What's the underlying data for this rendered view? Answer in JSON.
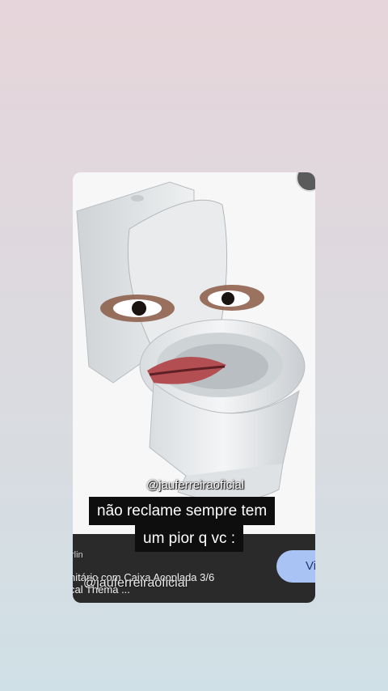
{
  "ad": {
    "seller": "rlin",
    "product_title_line1": "nitário com Caixa Acoplada 3/6",
    "product_title_line2": "cal Thema ...",
    "visit_label": "Vis"
  },
  "watermark": {
    "top": "@jauferreiraoficial",
    "bottom": "@jauferreiraoficial"
  },
  "caption": {
    "line1": "não reclame sempre tem",
    "line2": "um pior q vc :"
  },
  "colors": {
    "caption_bg": "#0e0e0e",
    "info_bar_bg": "#2a2a2a",
    "visit_button_bg": "#a9c4f4"
  }
}
